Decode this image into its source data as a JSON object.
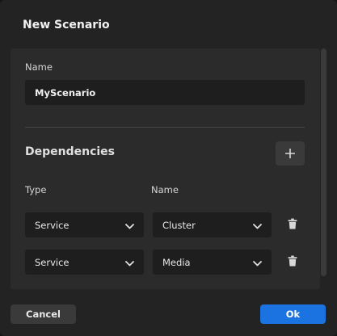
{
  "dialog": {
    "title": "New Scenario"
  },
  "name_field": {
    "label": "Name",
    "value": "MyScenario"
  },
  "dependencies": {
    "title": "Dependencies",
    "add_icon": "plus-icon",
    "columns": {
      "type": "Type",
      "name": "Name"
    },
    "rows": [
      {
        "type": "Service",
        "name": "Cluster"
      },
      {
        "type": "Service",
        "name": "Media"
      }
    ],
    "remove_icon": "trash-icon",
    "dropdown_icon": "chevron-down-icon"
  },
  "footer": {
    "cancel_label": "Cancel",
    "ok_label": "Ok"
  },
  "colors": {
    "dialog_bg": "#232323",
    "panel_bg": "#2b2b2b",
    "input_bg": "#1e1e1e",
    "primary": "#1a73e0"
  }
}
